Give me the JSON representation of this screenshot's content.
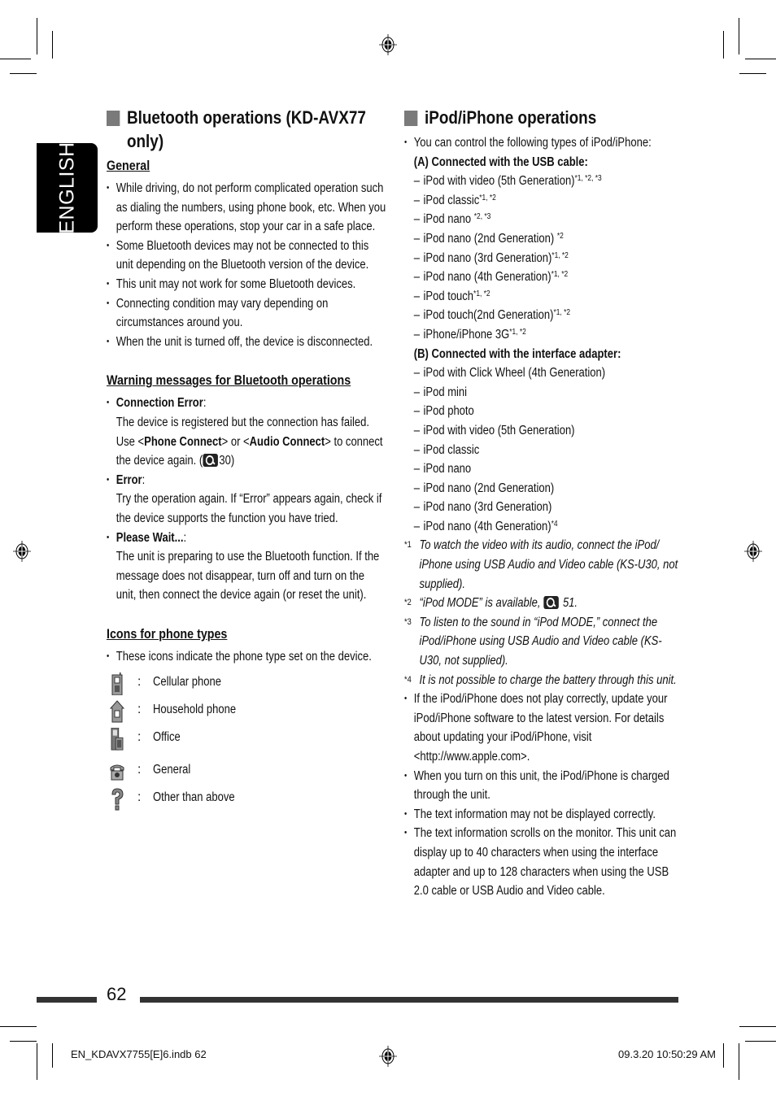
{
  "language_tab": "ENGLISH",
  "left": {
    "title": "Bluetooth operations (KD-AVX77 only)",
    "general": {
      "heading": "General",
      "bullets": [
        "While driving, do not perform complicated operation such as dialing the numbers, using phone book, etc. When you perform these operations, stop your car in a safe place.",
        "Some Bluetooth devices may not be connected to this unit depending on the Bluetooth version of the device.",
        "This unit may not work for some Bluetooth devices.",
        "Connecting condition may vary depending on circumstances around you.",
        "When the unit is turned off, the device is disconnected."
      ]
    },
    "warnings": {
      "heading": "Warning messages for Bluetooth operations",
      "items": [
        {
          "name": "Connection Error",
          "text1": "The device is registered but the connection has failed. Use <",
          "bold1": "Phone Connect",
          "text2": "> or <",
          "bold2": "Audio Connect",
          "text3": "> to connect the device again. (",
          "ref": "30",
          "text4": ")"
        },
        {
          "name": "Error",
          "text": "Try the operation again. If “Error” appears again, check if the device supports the function you have tried."
        },
        {
          "name": "Please Wait...",
          "text": "The unit is preparing to use the Bluetooth function. If the message does not disappear, turn off and turn on the unit, then connect the device again (or reset the unit)."
        }
      ]
    },
    "icons": {
      "heading": "Icons for phone types",
      "intro": "These icons indicate the phone type set on the device.",
      "types": [
        {
          "icon": "cellular-phone-icon",
          "label": "Cellular phone"
        },
        {
          "icon": "household-phone-icon",
          "label": "Household phone"
        },
        {
          "icon": "office-icon",
          "label": "Office"
        },
        {
          "icon": "general-phone-icon",
          "label": "General"
        },
        {
          "icon": "question-mark-icon",
          "label": "Other than above"
        }
      ]
    }
  },
  "right": {
    "title": "iPod/iPhone operations",
    "intro": "You can control the following types of iPod/iPhone:",
    "group_a": {
      "heading": "(A) Connected with the USB cable:",
      "items": [
        {
          "name": "iPod with video (5th Generation)",
          "notes": "*1, *2, *3"
        },
        {
          "name": "iPod classic",
          "notes": "*1, *2"
        },
        {
          "name": "iPod nano ",
          "notes": "*2, *3"
        },
        {
          "name": "iPod nano (2nd Generation) ",
          "notes": "*2"
        },
        {
          "name": "iPod nano (3rd Generation)",
          "notes": "*1, *2"
        },
        {
          "name": "iPod nano (4th Generation)",
          "notes": "*1, *2"
        },
        {
          "name": "iPod touch",
          "notes": "*1, *2"
        },
        {
          "name": "iPod touch(2nd Generation)",
          "notes": "*1, *2"
        },
        {
          "name": "iPhone/iPhone 3G",
          "notes": "*1, *2"
        }
      ]
    },
    "group_b": {
      "heading": "(B) Connected with the interface adapter:",
      "items": [
        {
          "name": "iPod with Click Wheel (4th Generation)",
          "notes": ""
        },
        {
          "name": "iPod mini",
          "notes": ""
        },
        {
          "name": "iPod photo",
          "notes": ""
        },
        {
          "name": "iPod with video (5th Generation)",
          "notes": ""
        },
        {
          "name": "iPod classic",
          "notes": ""
        },
        {
          "name": "iPod nano",
          "notes": ""
        },
        {
          "name": "iPod nano (2nd Generation)",
          "notes": ""
        },
        {
          "name": "iPod nano (3rd Generation)",
          "notes": ""
        },
        {
          "name": "iPod nano (4th Generation)",
          "notes": "*4"
        }
      ]
    },
    "footnotes": [
      {
        "mark": "*1",
        "text": "To watch the video with its audio, connect the iPod/ iPhone using USB Audio and Video cable (KS-U30, not supplied)."
      },
      {
        "mark": "*2",
        "text": "“iPod MODE” is available, ",
        "ref": "51."
      },
      {
        "mark": "*3",
        "text": "To listen to the sound in “iPod MODE,” connect the iPod/iPhone using USB Audio and Video cable (KS- U30, not supplied)."
      },
      {
        "mark": "*4",
        "text": "It is not possible to charge the battery through this unit."
      }
    ],
    "bullets": [
      "If the iPod/iPhone does not play correctly, update your iPod/iPhone software to the latest version. For details about updating your iPod/iPhone, visit <http://www.apple.com>.",
      "When you turn on this unit, the iPod/iPhone is charged through the unit.",
      "The text information may not be displayed correctly.",
      "The text information scrolls on the monitor. This unit can display up to 40 characters when using the interface adapter and up to 128 characters when using the USB 2.0 cable or USB Audio and Video cable."
    ]
  },
  "page_number": "62",
  "footer": {
    "file": "EN_KDAVX7755[E]6.indb   62",
    "timestamp": "09.3.20   10:50:29 AM"
  }
}
